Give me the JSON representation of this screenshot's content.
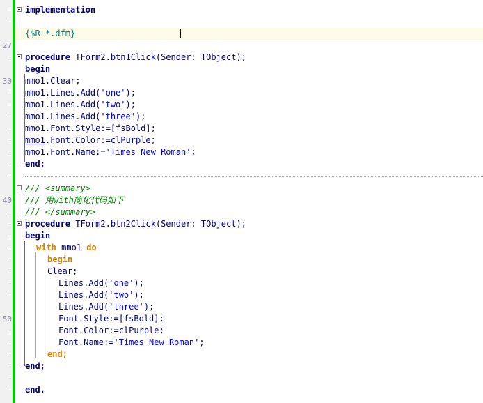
{
  "editor": {
    "line_numbers": {
      "l1": "27",
      "l2": "30",
      "l3": "40",
      "l4": "50"
    },
    "lines": {
      "implementation": "implementation",
      "directive": "{$R *.dfm}",
      "proc1_kw": "procedure",
      "proc1_rest": " TForm2.btn1Click(Sender: TObject);",
      "begin1": "begin",
      "m1": "mmo1.Clear;",
      "m2_a": "mmo1.Lines.Add(",
      "m2_s": "'one'",
      "m2_b": ");",
      "m3_a": "mmo1.Lines.Add(",
      "m3_s": "'two'",
      "m3_b": ");",
      "m4_a": "mmo1.Lines.Add(",
      "m4_s": "'three'",
      "m4_b": ");",
      "m5": "mmo1.Font.Style:=[fsBold];",
      "m6_a": "mmo1",
      "m6_b": ".Font.Color:=clPurple;",
      "m7_a": "mmo1.Font.Name:=",
      "m7_s": "'Times New Roman'",
      "m7_b": ";",
      "end1": "end;",
      "c1": "/// <summary>",
      "c2": "/// 用with简化代码如下",
      "c3": "/// </summary>",
      "proc2_kw": "procedure",
      "proc2_rest": " TForm2.btn2Click(Sender: TObject);",
      "begin2": "begin",
      "with_kw": "with",
      "with_mid": " mmo1 ",
      "do_kw": "do",
      "begin3": "begin",
      "w1": "Clear;",
      "w2_a": "Lines.Add(",
      "w2_s": "'one'",
      "w2_b": ");",
      "w3_a": "Lines.Add(",
      "w3_s": "'two'",
      "w3_b": ");",
      "w4_a": "Lines.Add(",
      "w4_s": "'three'",
      "w4_b": ");",
      "w5": "Font.Style:=[fsBold];",
      "w6": "Font.Color:=clPurple;",
      "w7_a": "Font.Name:=",
      "w7_s": "'Times New Roman'",
      "w7_b": ";",
      "end3": "end;",
      "end2": "end;",
      "end_final": "end."
    }
  }
}
